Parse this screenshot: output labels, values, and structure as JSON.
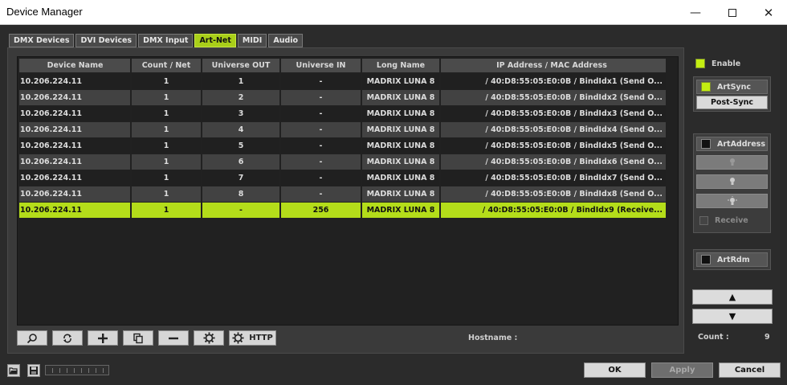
{
  "window": {
    "title": "Device Manager",
    "minimize": "—",
    "close": "✕"
  },
  "tabs": [
    {
      "label": "DMX Devices",
      "active": false
    },
    {
      "label": "DVI Devices",
      "active": false
    },
    {
      "label": "DMX Input",
      "active": false
    },
    {
      "label": "Art-Net",
      "active": true
    },
    {
      "label": "MIDI",
      "active": false
    },
    {
      "label": "Audio",
      "active": false
    }
  ],
  "table": {
    "columns": [
      "Device Name",
      "Count / Net",
      "Universe OUT",
      "Universe IN",
      "Long Name",
      "IP Address / MAC Address"
    ],
    "rows": [
      [
        "10.206.224.11",
        "1",
        "1",
        "-",
        "MADRIX LUNA 8",
        "/ 40:D8:55:05:E0:0B / BindIdx1 (Send O..."
      ],
      [
        "10.206.224.11",
        "1",
        "2",
        "-",
        "MADRIX LUNA 8",
        "/ 40:D8:55:05:E0:0B / BindIdx2 (Send O..."
      ],
      [
        "10.206.224.11",
        "1",
        "3",
        "-",
        "MADRIX LUNA 8",
        "/ 40:D8:55:05:E0:0B / BindIdx3 (Send O..."
      ],
      [
        "10.206.224.11",
        "1",
        "4",
        "-",
        "MADRIX LUNA 8",
        "/ 40:D8:55:05:E0:0B / BindIdx4 (Send O..."
      ],
      [
        "10.206.224.11",
        "1",
        "5",
        "-",
        "MADRIX LUNA 8",
        "/ 40:D8:55:05:E0:0B / BindIdx5 (Send O..."
      ],
      [
        "10.206.224.11",
        "1",
        "6",
        "-",
        "MADRIX LUNA 8",
        "/ 40:D8:55:05:E0:0B / BindIdx6 (Send O..."
      ],
      [
        "10.206.224.11",
        "1",
        "7",
        "-",
        "MADRIX LUNA 8",
        "/ 40:D8:55:05:E0:0B / BindIdx7 (Send O..."
      ],
      [
        "10.206.224.11",
        "1",
        "8",
        "-",
        "MADRIX LUNA 8",
        "/ 40:D8:55:05:E0:0B / BindIdx8 (Send O..."
      ],
      [
        "10.206.224.11",
        "1",
        "-",
        "256",
        "MADRIX LUNA 8",
        "/ 40:D8:55:05:E0:0B / BindIdx9 (Receive..."
      ]
    ],
    "selected_row": 8
  },
  "toolbar": {
    "http_label": "HTTP"
  },
  "hostname_label": "Hostname :",
  "count_label": "Count :",
  "count_value": "9",
  "right": {
    "enable_label": "Enable",
    "artsync_label": "ArtSync",
    "postsync_label": "Post-Sync",
    "artaddress_label": "ArtAddress",
    "receive_label": "Receive",
    "artrdm_label": "ArtRdm",
    "up_arrow": "▲",
    "down_arrow": "▼"
  },
  "footer": {
    "ok": "OK",
    "apply": "Apply",
    "cancel": "Cancel"
  },
  "colors": {
    "accent": "#b4dd1a",
    "background": "#2b2b2b"
  }
}
